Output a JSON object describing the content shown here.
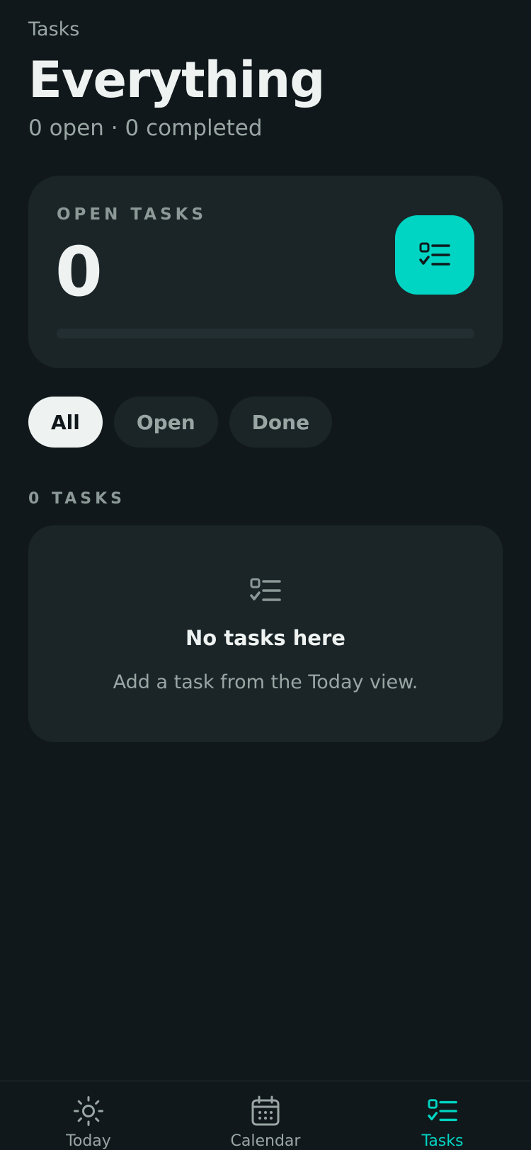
{
  "header": {
    "eyebrow": "Tasks",
    "title": "Everything",
    "subtitle": "0 open · 0 completed"
  },
  "stat_card": {
    "label": "OPEN TASKS",
    "value": "0",
    "icon": "task-list-icon",
    "progress": 0
  },
  "filters": {
    "items": [
      {
        "label": "All",
        "active": true
      },
      {
        "label": "Open",
        "active": false
      },
      {
        "label": "Done",
        "active": false
      }
    ]
  },
  "task_list": {
    "section_label": "0 TASKS",
    "empty": {
      "icon": "task-list-icon",
      "title": "No tasks here",
      "subtitle": "Add a task from the Today view."
    }
  },
  "tabbar": {
    "items": [
      {
        "label": "Today",
        "icon": "sun-icon",
        "active": false
      },
      {
        "label": "Calendar",
        "icon": "calendar-icon",
        "active": false
      },
      {
        "label": "Tasks",
        "icon": "task-list-icon",
        "active": true
      }
    ]
  },
  "colors": {
    "background": "#10181b",
    "card": "#1b2528",
    "accent": "#00d4c2",
    "text_primary": "#eef2f1",
    "text_secondary": "#9aa6a4"
  }
}
